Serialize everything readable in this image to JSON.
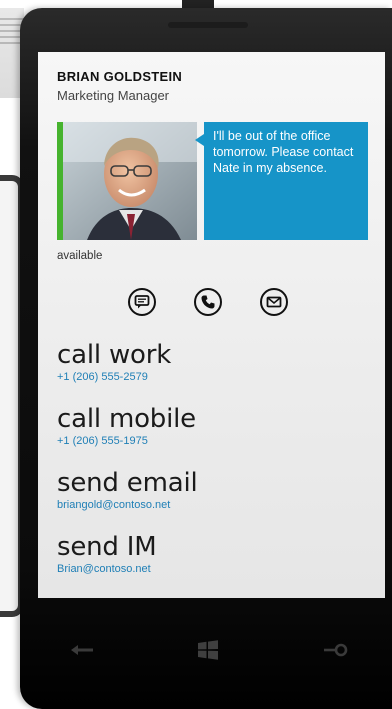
{
  "contact": {
    "name": "BRIAN GOLDSTEIN",
    "title": "Marketing Manager",
    "status_message": "I'll be out of the office tomorrow. Please contact Nate in my absence.",
    "availability": "available"
  },
  "quick_actions": [
    {
      "icon": "message-icon"
    },
    {
      "icon": "phone-icon"
    },
    {
      "icon": "email-icon"
    }
  ],
  "actions": [
    {
      "label": "call work",
      "detail": "+1 (206) 555-2579"
    },
    {
      "label": "call mobile",
      "detail": "+1 (206) 555-1975"
    },
    {
      "label": "send email",
      "detail": "briangold@contoso.net"
    },
    {
      "label": "send IM",
      "detail": "Brian@contoso.net"
    }
  ],
  "hardware_buttons": {
    "back": "back-arrow-icon",
    "start": "windows-logo-icon",
    "search": "search-icon"
  },
  "colors": {
    "accent": "#1694c8",
    "presence": "#46b32e",
    "link": "#1f7fb6"
  }
}
